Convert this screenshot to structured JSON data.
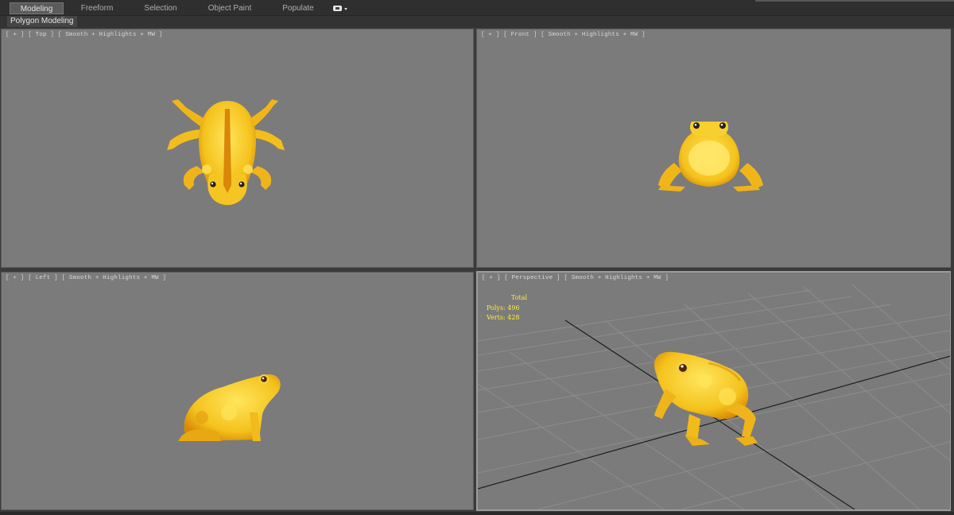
{
  "ribbon": {
    "tabs": [
      {
        "label": "Modeling",
        "active": true
      },
      {
        "label": "Freeform",
        "active": false
      },
      {
        "label": "Selection",
        "active": false
      },
      {
        "label": "Object Paint",
        "active": false
      },
      {
        "label": "Populate",
        "active": false
      }
    ],
    "extra_icon": "display-options-icon"
  },
  "panel": {
    "label": "Polygon Modeling"
  },
  "viewports": {
    "top": {
      "label": "[ + ] [ Top ] [ Smooth + Highlights + MW ]"
    },
    "front": {
      "label": "[ + ] [ Front ] [ Smooth + Highlights + MW ]"
    },
    "left": {
      "label": "[ + ] [ Left ] [ Smooth + Highlights + MW ]"
    },
    "perspective": {
      "label": "[ + ] [ Perspective ] [ Smooth + Highlights + MW ]",
      "active": true,
      "stats": {
        "title": "Total",
        "polys_label": "Polys:",
        "polys_value": "496",
        "verts_label": "Verts:",
        "verts_value": "428"
      }
    }
  },
  "colors": {
    "viewport_bg": "#7b7b7b",
    "frog_main": "#f4c21c",
    "frog_light": "#ffe55c",
    "frog_dark": "#d88a06",
    "stats_text": "#ffea3a",
    "grid_line": "#8d8d8d",
    "axis_line": "#1e1e1e"
  }
}
